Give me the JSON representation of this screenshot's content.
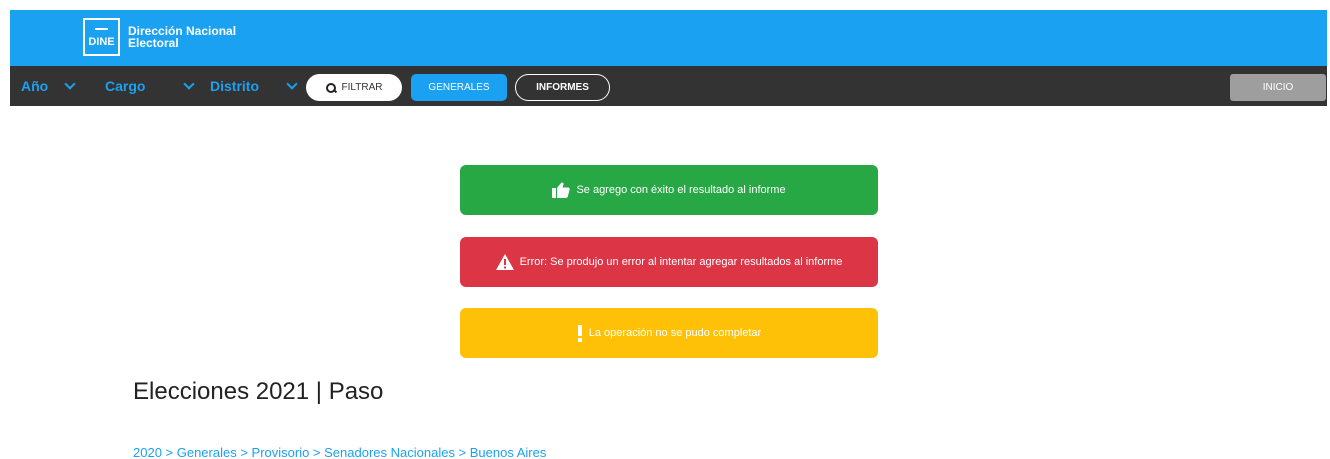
{
  "header": {
    "logo_text": "DINE",
    "title": "Dirección Nacional Electoral"
  },
  "nav": {
    "ano": "Año",
    "cargo": "Cargo",
    "distrito": "Distrito",
    "filtrar": "FILTRAR",
    "generales": "GENERALES",
    "informes": "INFORMES",
    "inicio": "INICIO"
  },
  "alerts": {
    "success": "Se agrego con éxito el resultado al informe",
    "error": "Error: Se produjo un error al intentar agregar resultados al informe",
    "warning": "La operación no se pudo completar"
  },
  "main": {
    "title": "Elecciones 2021 | Paso",
    "breadcrumb": "2020 > Generales > Provisorio > Senadores Nacionales > Buenos Aires"
  },
  "colors": {
    "brand": "#1ba1f2",
    "nav_bg": "#333333",
    "success": "#28a745",
    "error": "#dc3545",
    "warning": "#ffc107",
    "inicio": "#9e9e9e"
  },
  "icons": {
    "success": "thumbs-up-icon",
    "error": "warning-triangle-icon",
    "warning": "exclamation-icon",
    "filter": "search-icon"
  }
}
